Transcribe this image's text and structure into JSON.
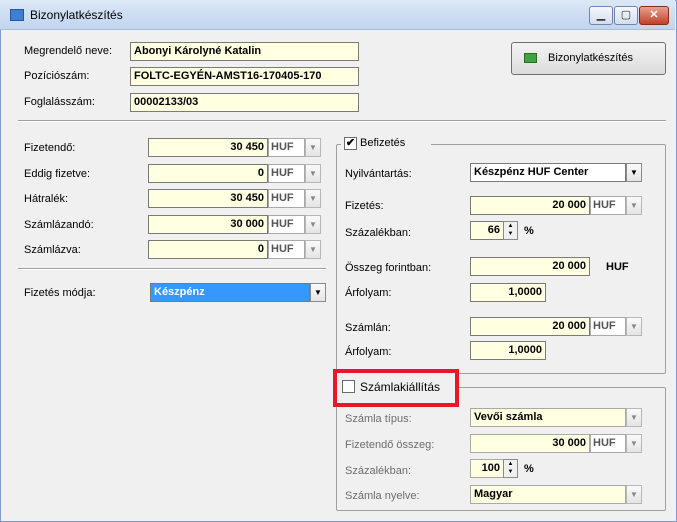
{
  "window": {
    "title": "Bizonylatkészítés",
    "minimize_icon": "minimize-icon",
    "maximize_icon": "maximize-icon",
    "close_icon": "close-icon"
  },
  "header": {
    "megrendelo_label": "Megrendelő neve:",
    "megrendelo_value": "Abonyi Károlyné Katalin",
    "pozicio_label": "Pozíciószám:",
    "pozicio_value": "FOLTC-EGYÉN-AMST16-170405-170",
    "foglalas_label": "Foglalásszám:",
    "foglalas_value": "00002133/03",
    "bizonylat_button": "Bizonylatkészítés"
  },
  "left": {
    "fizetendo_label": "Fizetendő:",
    "fizetendo_value": "30 450",
    "fizetendo_cur": "HUF",
    "eddig_label": "Eddig fizetve:",
    "eddig_value": "0",
    "eddig_cur": "HUF",
    "hatralek_label": "Hátralék:",
    "hatralek_value": "30 450",
    "hatralek_cur": "HUF",
    "szamlazando_label": "Számlázandó:",
    "szamlazando_value": "30 000",
    "szamlazando_cur": "HUF",
    "szamlazva_label": "Számlázva:",
    "szamlazva_value": "0",
    "szamlazva_cur": "HUF",
    "fizmod_label": "Fizetés módja:",
    "fizmod_value": "Készpénz"
  },
  "befizetes": {
    "title": "Befizetés",
    "checked_mark": "✔",
    "nyilv_label": "Nyilvántartás:",
    "nyilv_value": "Készpénz HUF Center",
    "fizetes_label": "Fizetés:",
    "fizetes_value": "20 000",
    "fizetes_cur": "HUF",
    "szazalek_label": "Százalékban:",
    "szazalek_value": "66",
    "pct_sign": "%",
    "osszeg_label": "Összeg forintban:",
    "osszeg_value": "20 000",
    "osszeg_cur": "HUF",
    "arfolyam1_label": "Árfolyam:",
    "arfolyam1_value": "1,0000",
    "szamlan_label": "Számlán:",
    "szamlan_value": "20 000",
    "szamlan_cur": "HUF",
    "arfolyam2_label": "Árfolyam:",
    "arfolyam2_value": "1,0000"
  },
  "szamla": {
    "title": "Számlakiállítás",
    "tipus_label": "Számla típus:",
    "tipus_value": "Vevői számla",
    "fizetendo_label": "Fizetendő összeg:",
    "fizetendo_value": "30 000",
    "fizetendo_cur": "HUF",
    "szazalek_label": "Százalékban:",
    "szazalek_value": "100",
    "pct_sign": "%",
    "nyelv_label": "Számla nyelve:",
    "nyelv_value": "Magyar"
  },
  "colors": {
    "accent_highlight": "#e8182a",
    "field_bg": "#ffffe1",
    "selection": "#3399ff"
  }
}
